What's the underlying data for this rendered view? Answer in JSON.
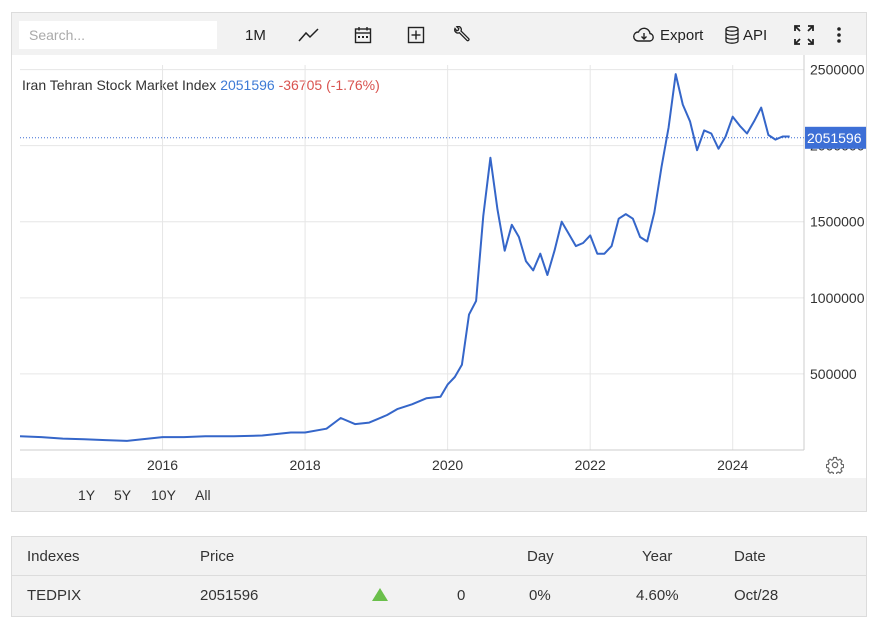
{
  "toolbar": {
    "search_placeholder": "Search...",
    "interval_label": "1M",
    "export_label": "Export",
    "api_label": "API"
  },
  "title": {
    "name": "Iran Tehran Stock Market Index",
    "value": "2051596",
    "change": "-36705 (-1.76%)"
  },
  "ranges": [
    "1Y",
    "5Y",
    "10Y",
    "All"
  ],
  "colors": {
    "line": "#3566c9",
    "last_value_bg": "#3d6fd6",
    "change": "#d9534f",
    "value": "#3d7ad6",
    "up_arrow": "#6abf4b"
  },
  "chart_data": {
    "type": "line",
    "title": "Iran Tehran Stock Market Index",
    "xlabel": "",
    "ylabel": "",
    "x_ticks": [
      "2016",
      "2018",
      "2020",
      "2022",
      "2024"
    ],
    "y_ticks": [
      "500000",
      "1000000",
      "1500000",
      "2000000",
      "2500000"
    ],
    "xlim": [
      2014.0,
      2025.0
    ],
    "ylim": [
      0,
      2530000
    ],
    "grid": true,
    "last_value_label": "2051596",
    "series": [
      {
        "x": [
          2014.0,
          2014.3,
          2014.6,
          2014.9,
          2015.2,
          2015.5,
          2015.8,
          2016.0,
          2016.3,
          2016.6,
          2017.0,
          2017.4,
          2017.8,
          2018.0,
          2018.3,
          2018.5,
          2018.7,
          2018.9,
          2019.0,
          2019.15,
          2019.3,
          2019.5,
          2019.7,
          2019.9,
          2020.0,
          2020.1,
          2020.2,
          2020.3,
          2020.4,
          2020.5,
          2020.6,
          2020.7,
          2020.8,
          2020.9,
          2021.0,
          2021.1,
          2021.2,
          2021.3,
          2021.4,
          2021.5,
          2021.6,
          2021.7,
          2021.8,
          2021.9,
          2022.0,
          2022.1,
          2022.2,
          2022.3,
          2022.4,
          2022.5,
          2022.6,
          2022.7,
          2022.8,
          2022.9,
          2023.0,
          2023.1,
          2023.2,
          2023.3,
          2023.4,
          2023.5,
          2023.6,
          2023.7,
          2023.8,
          2023.9,
          2024.0,
          2024.1,
          2024.2,
          2024.3,
          2024.4,
          2024.5,
          2024.6,
          2024.7,
          2024.8
        ],
        "y": [
          90000,
          85000,
          75000,
          70000,
          65000,
          60000,
          75000,
          85000,
          85000,
          90000,
          90000,
          95000,
          115000,
          115000,
          140000,
          210000,
          170000,
          180000,
          200000,
          230000,
          270000,
          300000,
          340000,
          350000,
          430000,
          480000,
          560000,
          890000,
          980000,
          1540000,
          1920000,
          1580000,
          1310000,
          1480000,
          1400000,
          1240000,
          1180000,
          1290000,
          1150000,
          1310000,
          1500000,
          1420000,
          1340000,
          1360000,
          1410000,
          1290000,
          1290000,
          1340000,
          1520000,
          1550000,
          1520000,
          1400000,
          1370000,
          1560000,
          1860000,
          2120000,
          2470000,
          2270000,
          2160000,
          1970000,
          2100000,
          2080000,
          1980000,
          2060000,
          2190000,
          2130000,
          2080000,
          2160000,
          2250000,
          2070000,
          2040000,
          2060000,
          2060000
        ]
      }
    ]
  },
  "table": {
    "headers": [
      "Indexes",
      "Price",
      "",
      "Day",
      "Year",
      "Date"
    ],
    "rows": [
      {
        "index": "TEDPIX",
        "price": "2051596",
        "change": "0",
        "day": "0%",
        "year": "4.60%",
        "date": "Oct/28"
      }
    ]
  }
}
